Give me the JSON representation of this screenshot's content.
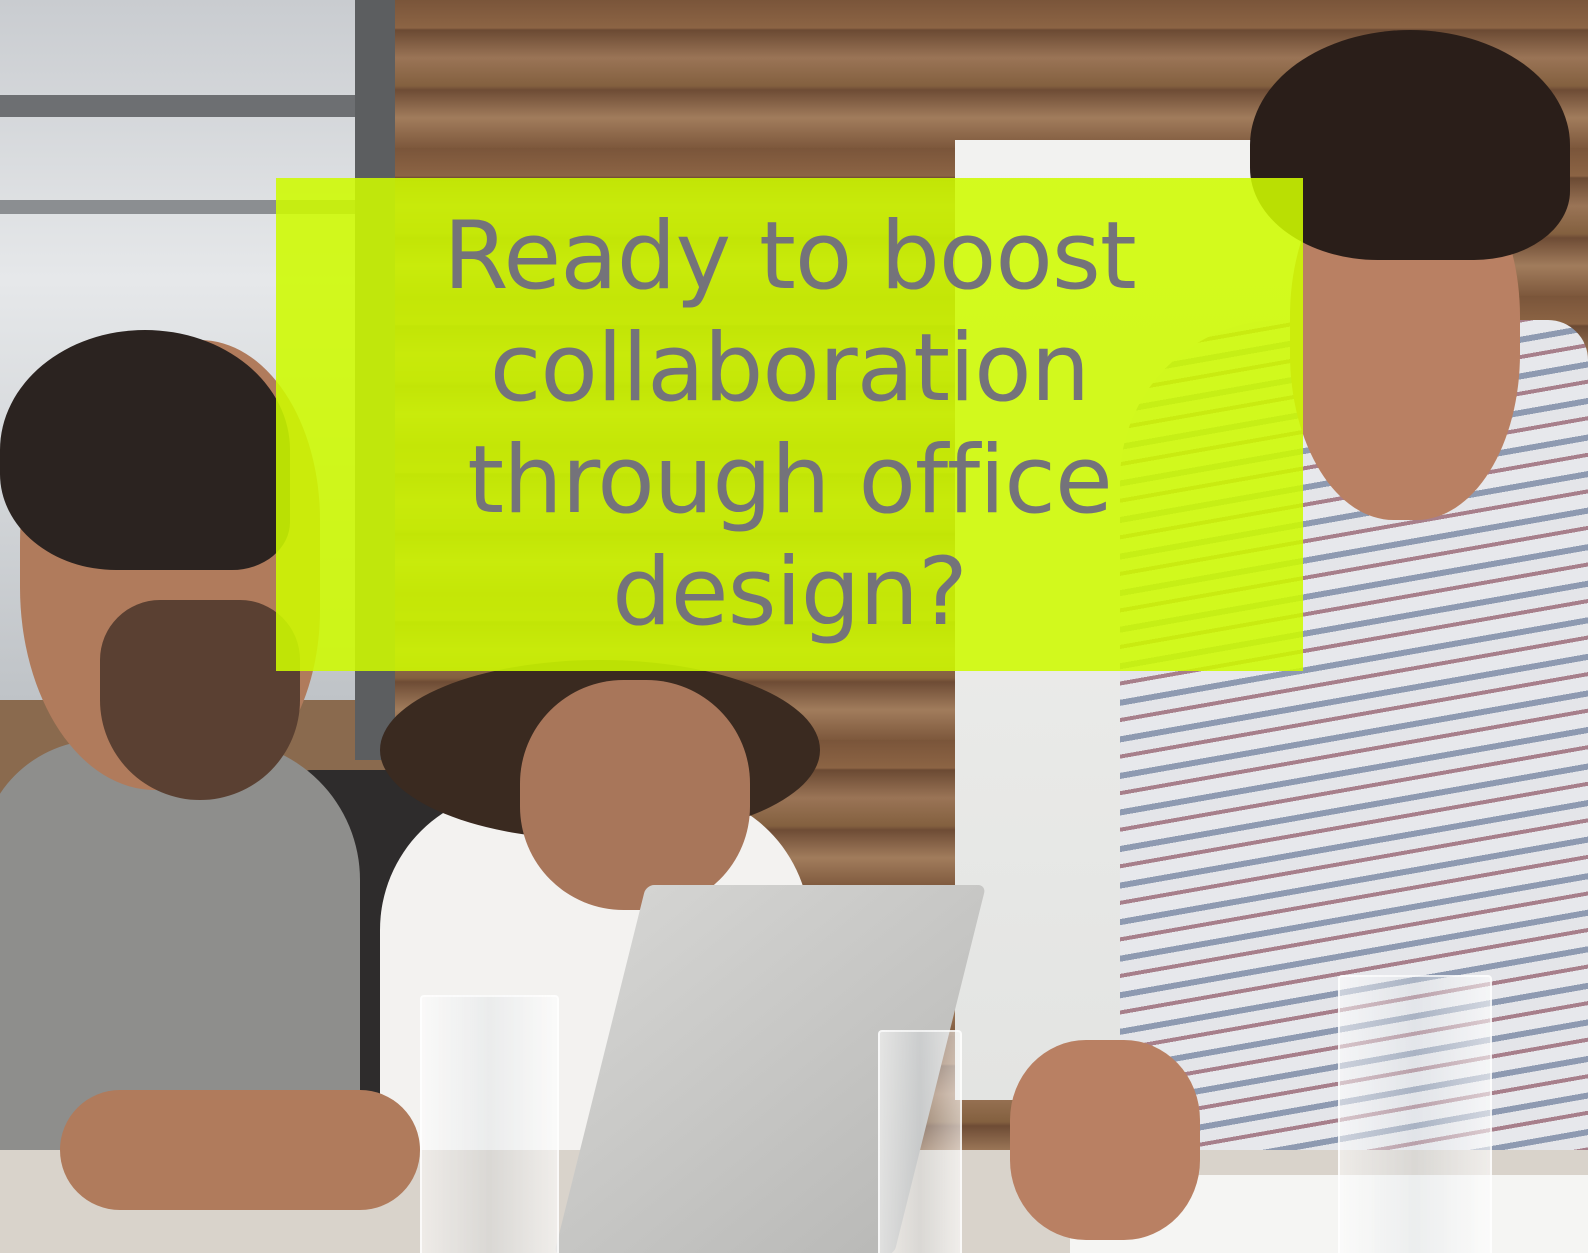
{
  "headline": {
    "lines": [
      "Ready to boost",
      "collaboration",
      "through office",
      "design?"
    ],
    "text_color": "#74737a",
    "box_color": "#cefa00"
  }
}
